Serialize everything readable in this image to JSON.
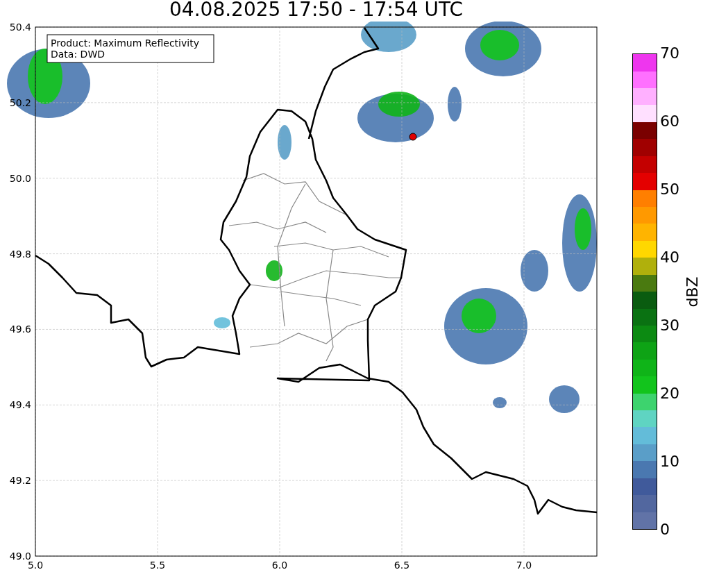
{
  "title": "04.08.2025 17:50 - 17:54 UTC",
  "map": {
    "info_lines": [
      "Product: Maximum Reflectivity",
      "Data: DWD"
    ],
    "xticks": [
      "5.0",
      "5.5",
      "6.0",
      "6.5",
      "7.0"
    ],
    "yticks": [
      "50.4",
      "50.2",
      "50.0",
      "49.8",
      "49.6",
      "49.4",
      "49.2",
      "49.0"
    ]
  },
  "colorbar": {
    "label": "dBZ",
    "ticks": [
      "70",
      "60",
      "50",
      "40",
      "30",
      "20",
      "10",
      "0"
    ]
  }
}
